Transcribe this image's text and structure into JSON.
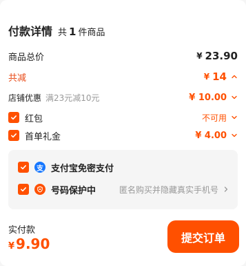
{
  "header": {
    "title": "付款详情",
    "count_prefix": "共",
    "count_num": "1",
    "count_suffix": "件商品"
  },
  "rows": {
    "total": {
      "label": "商品总价",
      "currency": "¥",
      "amount": "23.90"
    },
    "reduce": {
      "label": "共减",
      "currency": "¥",
      "amount": "14"
    },
    "shop": {
      "label": "店铺优惠",
      "sub": "满23元减10元",
      "value": "¥ 10.00"
    },
    "hongbao": {
      "label": "红包",
      "value": "不可用"
    },
    "shoudan": {
      "label": "首单礼金",
      "value": "¥ 4.00"
    }
  },
  "services": {
    "alipay": {
      "label": "支付宝免密支付",
      "icon_char": "支"
    },
    "phone": {
      "label": "号码保护中",
      "desc": "匿名购买并隐藏真实手机号"
    }
  },
  "footer": {
    "label": "实付款",
    "currency": "¥",
    "amount": "9.90",
    "submit_label": "提交订单"
  },
  "colors": {
    "accent": "#ff5000",
    "alipay_blue": "#1677ff",
    "muted": "#999999"
  },
  "icons": {
    "checkbox": "checkmark-icon",
    "chevron_up": "chevron-up-icon",
    "chevron_down": "chevron-down-icon",
    "chevron_right": "chevron-right-icon",
    "alipay": "alipay-icon",
    "shield": "shield-icon"
  }
}
